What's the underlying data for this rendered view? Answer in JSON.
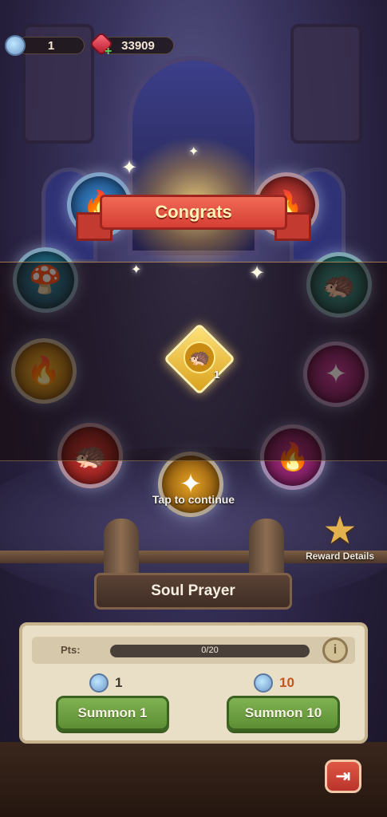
{
  "currency": {
    "tickets": "1",
    "gems": "33909",
    "ticket_icon": "summon-ticket-icon",
    "gem_icon": "ruby-gem-icon"
  },
  "banner": {
    "title": "Congrats"
  },
  "reward": {
    "count": "1",
    "icon": "golden-soul-sigil-icon"
  },
  "prompt": {
    "tap_to_continue": "Tap to continue"
  },
  "reward_details": {
    "label": "Reward Details",
    "icon": "star-icon"
  },
  "pool": {
    "title": "Soul Prayer"
  },
  "panel": {
    "pts_label": "Pts:",
    "progress_text": "0/20",
    "progress_fraction": 0,
    "info_icon": "info-icon",
    "summon_1": {
      "cost": "1",
      "label": "Summon 1"
    },
    "summon_10": {
      "cost": "10",
      "label": "Summon 10"
    }
  },
  "colors": {
    "summon_green": "#6fa143",
    "ribbon_red": "#d63e34",
    "panel_bg": "#e9dfc7",
    "cost_10_color": "#e07a2c"
  }
}
